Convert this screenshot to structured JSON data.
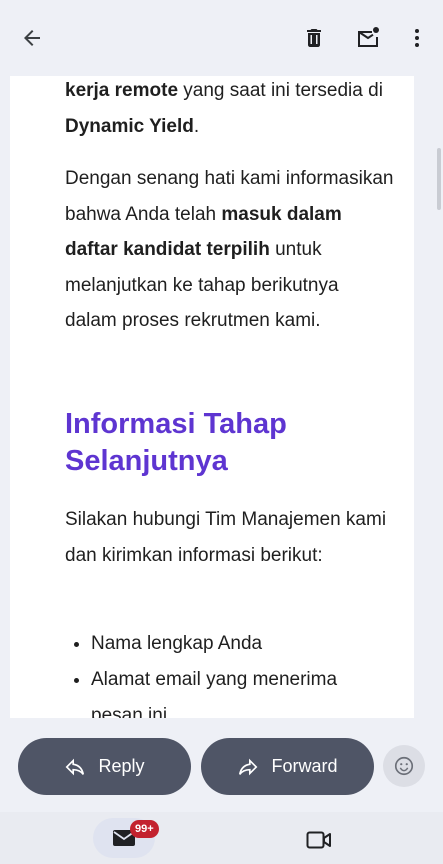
{
  "toolbar": {
    "back_icon": "arrow-back-icon",
    "delete_icon": "trash-icon",
    "mark_unread_icon": "mail-unread-icon",
    "more_icon": "more-vert-icon"
  },
  "email": {
    "para1": {
      "b1": "kerja remote",
      "t1": " yang saat ini tersedia di ",
      "b2": "Dynamic Yield",
      "t2": "."
    },
    "para2": {
      "t1": "Dengan senang hati kami informasikan bahwa Anda telah ",
      "b1": "masuk dalam daftar kandidat terpilih",
      "t2": " untuk melanjutkan ke tahap berikutnya dalam proses rekrutmen kami."
    },
    "heading": "Informasi Tahap Selanjutnya",
    "para3": "Silakan hubungi Tim Manajemen kami dan kirimkan informasi berikut:",
    "list": [
      "Nama lengkap Anda",
      "Alamat email yang menerima pesan ini"
    ]
  },
  "actions": {
    "reply_label": "Reply",
    "forward_label": "Forward"
  },
  "nav": {
    "mail_badge": "99+"
  },
  "colors": {
    "accent_heading": "#5e35d1",
    "pill": "#4f5566",
    "badge": "#c3222f"
  }
}
